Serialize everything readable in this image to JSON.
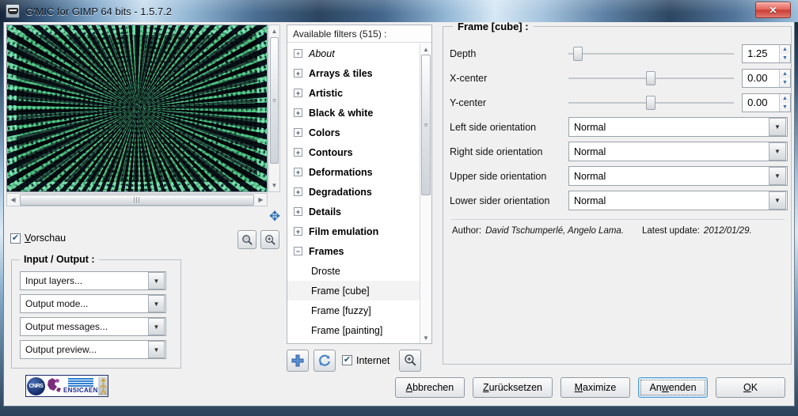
{
  "window": {
    "title": "G'MIC for GIMP 64 bits - 1.5.7.2",
    "close_label": "✕",
    "app_icon": "gmic-gimp-icon"
  },
  "preview": {
    "checkbox_label": "Vorschau",
    "checkbox_checked": true,
    "zoom_out_icon": "magnifier-minus-icon",
    "zoom_in_icon": "magnifier-plus-icon",
    "pan_icon": "move-arrows-icon",
    "image_colors": {
      "light": "#9fe0bd",
      "dark": "#0d1420"
    }
  },
  "io_group": {
    "title": "Input / Output :",
    "combos": [
      {
        "name": "input-layers",
        "value": "Input layers..."
      },
      {
        "name": "output-mode",
        "value": "Output mode..."
      },
      {
        "name": "output-messages",
        "value": "Output messages..."
      },
      {
        "name": "output-preview",
        "value": "Output preview..."
      }
    ]
  },
  "logo": {
    "cnrs": "CNRS",
    "ensicaen": "ENSICAEN"
  },
  "filters": {
    "header": "Available filters (515) :",
    "items": [
      {
        "label": "About",
        "type": "category",
        "expanded": false,
        "italic": true,
        "selected": false
      },
      {
        "label": "Arrays & tiles",
        "type": "category",
        "expanded": false,
        "italic": false,
        "selected": false
      },
      {
        "label": "Artistic",
        "type": "category",
        "expanded": false,
        "italic": false,
        "selected": false
      },
      {
        "label": "Black & white",
        "type": "category",
        "expanded": false,
        "italic": false,
        "selected": false
      },
      {
        "label": "Colors",
        "type": "category",
        "expanded": false,
        "italic": false,
        "selected": false
      },
      {
        "label": "Contours",
        "type": "category",
        "expanded": false,
        "italic": false,
        "selected": false
      },
      {
        "label": "Deformations",
        "type": "category",
        "expanded": false,
        "italic": false,
        "selected": false
      },
      {
        "label": "Degradations",
        "type": "category",
        "expanded": false,
        "italic": false,
        "selected": false
      },
      {
        "label": "Details",
        "type": "category",
        "expanded": false,
        "italic": false,
        "selected": false
      },
      {
        "label": "Film emulation",
        "type": "category",
        "expanded": false,
        "italic": false,
        "selected": false
      },
      {
        "label": "Frames",
        "type": "category",
        "expanded": true,
        "italic": false,
        "selected": false
      },
      {
        "label": "Droste",
        "type": "child",
        "selected": false
      },
      {
        "label": "Frame [cube]",
        "type": "child",
        "selected": true
      },
      {
        "label": "Frame [fuzzy]",
        "type": "child",
        "selected": false
      },
      {
        "label": "Frame [painting]",
        "type": "child",
        "selected": false
      }
    ],
    "toolbar": {
      "add_icon": "plus-icon",
      "refresh_icon": "refresh-icon",
      "internet_label": "Internet",
      "internet_checked": true,
      "search_icon": "magnifier-plus-icon"
    }
  },
  "params": {
    "title": "Frame [cube] :",
    "sliders": [
      {
        "label": "Depth",
        "value": "1.25",
        "position_pct": 6
      },
      {
        "label": "X-center",
        "value": "0.00",
        "position_pct": 50
      },
      {
        "label": "Y-center",
        "value": "0.00",
        "position_pct": 50
      }
    ],
    "dropdowns": [
      {
        "label": "Left side orientation",
        "value": "Normal"
      },
      {
        "label": "Right side orientation",
        "value": "Normal"
      },
      {
        "label": "Upper side orientation",
        "value": "Normal"
      },
      {
        "label": "Lower sider orientation",
        "value": "Normal"
      }
    ],
    "author_prefix": "Author:",
    "author_names": "David Tschumperlé, Angelo Lama.",
    "update_prefix": "Latest update:",
    "update_date": "2012/01/29."
  },
  "buttons": [
    {
      "name": "cancel-button",
      "pre": "A",
      "mnem": "",
      "post": "bbrechen",
      "full": "Abbrechen",
      "focused": false
    },
    {
      "name": "reset-button",
      "pre": "",
      "mnem": "Z",
      "post": "urücksetzen",
      "full": "Zurücksetzen",
      "focused": false
    },
    {
      "name": "maximize-button",
      "pre": "",
      "mnem": "M",
      "post": "aximize",
      "full": "Maximize",
      "focused": false
    },
    {
      "name": "apply-button",
      "pre": "An",
      "mnem": "w",
      "post": "enden",
      "full": "Anwenden",
      "focused": true
    },
    {
      "name": "ok-button",
      "pre": "",
      "mnem": "O",
      "post": "K",
      "full": "OK",
      "focused": false
    }
  ]
}
